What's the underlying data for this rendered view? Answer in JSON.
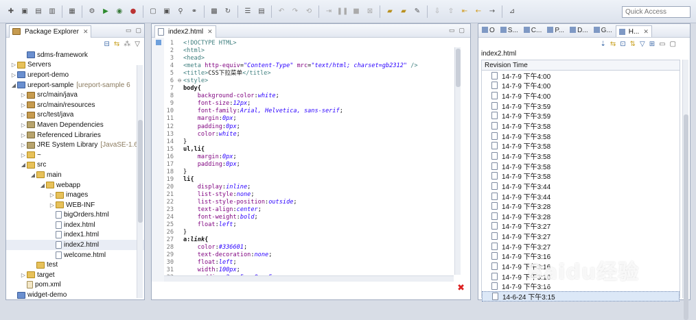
{
  "toolbar": {
    "quick_access_placeholder": "Quick Access"
  },
  "package_explorer": {
    "title": "Package Explorer",
    "close": "✕",
    "items": [
      {
        "label": "sdms-framework",
        "indent": 1,
        "arrow": "",
        "icon": "project-icon"
      },
      {
        "label": "Servers",
        "indent": 0,
        "arrow": "▷",
        "icon": "folder-icon"
      },
      {
        "label": "ureport-demo",
        "indent": 0,
        "arrow": "▷",
        "icon": "project-icon"
      },
      {
        "label": "ureport-sample",
        "decor": "[ureport-sample 6",
        "indent": 0,
        "arrow": "◢",
        "icon": "project-icon"
      },
      {
        "label": "src/main/java",
        "indent": 1,
        "arrow": "▷",
        "icon": "package-icon"
      },
      {
        "label": "src/main/resources",
        "indent": 1,
        "arrow": "▷",
        "icon": "package-icon"
      },
      {
        "label": "src/test/java",
        "indent": 1,
        "arrow": "▷",
        "icon": "package-icon"
      },
      {
        "label": "Maven Dependencies",
        "indent": 1,
        "arrow": "▷",
        "icon": "library-icon"
      },
      {
        "label": "Referenced Libraries",
        "indent": 1,
        "arrow": "▷",
        "icon": "library-icon"
      },
      {
        "label": "JRE System Library",
        "decor": "[JavaSE-1.6]",
        "indent": 1,
        "arrow": "▷",
        "icon": "library-icon"
      },
      {
        "label": "~",
        "indent": 1,
        "arrow": "▷",
        "icon": "folder-icon"
      },
      {
        "label": "src",
        "indent": 1,
        "arrow": "◢",
        "icon": "folder-icon"
      },
      {
        "label": "main",
        "indent": 2,
        "arrow": "◢",
        "icon": "folder-icon"
      },
      {
        "label": "webapp",
        "indent": 3,
        "arrow": "◢",
        "icon": "folder-icon"
      },
      {
        "label": "images",
        "indent": 4,
        "arrow": "▷",
        "icon": "folder-icon"
      },
      {
        "label": "WEB-INF",
        "indent": 4,
        "arrow": "▷",
        "icon": "folder-icon"
      },
      {
        "label": "bigOrders.html",
        "indent": 4,
        "arrow": "",
        "icon": "file-icon"
      },
      {
        "label": "index.html",
        "indent": 4,
        "arrow": "",
        "icon": "file-icon"
      },
      {
        "label": "index1.html",
        "indent": 4,
        "arrow": "",
        "icon": "file-icon"
      },
      {
        "label": "index2.html",
        "indent": 4,
        "arrow": "",
        "icon": "file-icon",
        "selected": true
      },
      {
        "label": "welcome.html",
        "indent": 4,
        "arrow": "",
        "icon": "file-icon"
      },
      {
        "label": "test",
        "indent": 2,
        "arrow": "",
        "icon": "folder-icon"
      },
      {
        "label": "target",
        "indent": 1,
        "arrow": "▷",
        "icon": "folder-icon"
      },
      {
        "label": "pom.xml",
        "indent": 1,
        "arrow": "",
        "icon": "xml-icon"
      },
      {
        "label": "widget-demo",
        "indent": 0,
        "arrow": "",
        "icon": "project-icon"
      }
    ]
  },
  "editor": {
    "tab_label": "index2.html",
    "close": "✕",
    "lines": [
      {
        "n": "1",
        "html": "<span class=\"tag\">&lt;!DOCTYPE HTML&gt;</span>"
      },
      {
        "n": "2",
        "html": "<span class=\"tag\">&lt;html&gt;</span>"
      },
      {
        "n": "3",
        "html": "<span class=\"tag\">&lt;head&gt;</span>"
      },
      {
        "n": "4",
        "html": "<span class=\"tag\">&lt;meta</span> <span class=\"attr\">http-equiv</span>=<span class=\"val\">\"Content-Type\"</span> <span class=\"attr\">mrc</span>=<span class=\"val\">\"text/html; charset=gb2312\"</span> <span class=\"tag\">/&gt;</span>"
      },
      {
        "n": "5",
        "html": "<span class=\"tag\">&lt;title&gt;</span>CSS下拉菜单<span class=\"tag\">&lt;/title&gt;</span>"
      },
      {
        "n": "6",
        "fold": "⊖",
        "html": "<span class=\"tag\">&lt;style&gt;</span>"
      },
      {
        "n": "7",
        "html": "<span class=\"sel\">body{</span>"
      },
      {
        "n": "8",
        "html": "    <span class=\"prop\">background-color</span>:<span class=\"pval\">white</span>;"
      },
      {
        "n": "9",
        "html": "    <span class=\"prop\">font-size</span>:<span class=\"pval\">12px</span>;"
      },
      {
        "n": "10",
        "html": "    <span class=\"prop\">font-family</span>:<span class=\"pval\">Arial, Helvetica, sans-serif</span>;"
      },
      {
        "n": "11",
        "html": "    <span class=\"prop\">margin</span>:<span class=\"pval\">0px</span>;"
      },
      {
        "n": "12",
        "html": "    <span class=\"prop\">padding</span>:<span class=\"pval\">0px</span>;"
      },
      {
        "n": "13",
        "html": "    <span class=\"prop\">color</span>:<span class=\"pval\">white</span>;"
      },
      {
        "n": "14",
        "html": "}"
      },
      {
        "n": "15",
        "html": "<span class=\"sel\">ul,li{</span>"
      },
      {
        "n": "16",
        "html": "    <span class=\"prop\">margin</span>:<span class=\"pval\">0px</span>;"
      },
      {
        "n": "17",
        "html": "    <span class=\"prop\">padding</span>:<span class=\"pval\">0px</span>;"
      },
      {
        "n": "18",
        "html": "}"
      },
      {
        "n": "19",
        "html": "<span class=\"sel\">li{</span>"
      },
      {
        "n": "20",
        "html": "    <span class=\"prop\">display</span>:<span class=\"pval\">inline</span>;"
      },
      {
        "n": "21",
        "html": "    <span class=\"prop\">list-style</span>:<span class=\"pval\">none</span>;"
      },
      {
        "n": "22",
        "html": "    <span class=\"prop\">list-style-position</span>:<span class=\"pval\">outside</span>;"
      },
      {
        "n": "23",
        "html": "    <span class=\"prop\">text-align</span>:<span class=\"pval\">center</span>;"
      },
      {
        "n": "24",
        "html": "    <span class=\"prop\">font-weight</span>:<span class=\"pval\">bold</span>;"
      },
      {
        "n": "25",
        "html": "    <span class=\"prop\">float</span>:<span class=\"pval\">left</span>;"
      },
      {
        "n": "26",
        "html": "}"
      },
      {
        "n": "27",
        "html": "<span class=\"sel\">a:<i>link</i>{</span>"
      },
      {
        "n": "28",
        "html": "    <span class=\"prop\">color</span>:<span class=\"pval\">#336601</span>;"
      },
      {
        "n": "29",
        "html": "    <span class=\"prop\">text-decoration</span>:<span class=\"pval\">none</span>;"
      },
      {
        "n": "30",
        "html": "    <span class=\"prop\">float</span>:<span class=\"pval\">left</span>;"
      },
      {
        "n": "31",
        "html": "    <span class=\"prop\">width</span>:<span class=\"pval\">100px</span>;"
      },
      {
        "n": "32",
        "html": "    <span class=\"prop\">padding</span>:<span class=\"pval\">3px 5px 0px 5px</span>;"
      }
    ]
  },
  "history": {
    "tabs": [
      "O",
      "S...",
      "C...",
      "P...",
      "D...",
      "G..."
    ],
    "active_tab": "H...",
    "file": "index2.html",
    "column": "Revision Time",
    "rows": [
      "14-7-9 下午4:00",
      "14-7-9 下午4:00",
      "14-7-9 下午4:00",
      "14-7-9 下午3:59",
      "14-7-9 下午3:59",
      "14-7-9 下午3:58",
      "14-7-9 下午3:58",
      "14-7-9 下午3:58",
      "14-7-9 下午3:58",
      "14-7-9 下午3:58",
      "14-7-9 下午3:58",
      "14-7-9 下午3:44",
      "14-7-9 下午3:44",
      "14-7-9 下午3:28",
      "14-7-9 下午3:28",
      "14-7-9 下午3:27",
      "14-7-9 下午3:27",
      "14-7-9 下午3:27",
      "14-7-9 下午3:16",
      "14-7-9 下午3:16",
      "14-7-9 下午3:16",
      "14-7-9 下午3:16",
      "14-6-24 下午3:15"
    ],
    "selected_index": 22
  },
  "watermark": {
    "text": "Baidu经验",
    "sub": "jingyan.baidu.com"
  }
}
